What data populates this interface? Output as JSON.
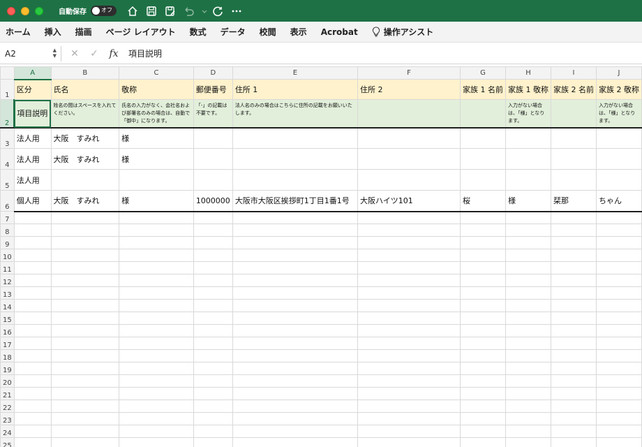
{
  "titlebar": {
    "autosave_label": "自動保存",
    "autosave_state": "オフ",
    "icons": [
      "home-icon",
      "save-icon",
      "save-as-icon",
      "undo-icon",
      "redo-icon",
      "more-icon"
    ]
  },
  "ribbon": {
    "tabs": [
      "ホーム",
      "挿入",
      "描画",
      "ページ レイアウト",
      "数式",
      "データ",
      "校閲",
      "表示",
      "Acrobat"
    ],
    "assist_label": "操作アシスト"
  },
  "formula_bar": {
    "name_box": "A2",
    "fx_label": "fx",
    "formula": "項目説明"
  },
  "grid": {
    "columns": [
      "A",
      "B",
      "C",
      "D",
      "E",
      "F",
      "G",
      "H",
      "I",
      "J"
    ],
    "selected_column": "A",
    "selected_row": 2,
    "rows": [
      {
        "n": "1",
        "cells": [
          "区分",
          "氏名",
          "敬称",
          "郵便番号",
          "住所 1",
          "住所 2",
          "家族 1 名前",
          "家族 1 敬称",
          "家族 2 名前",
          "家族 2 敬称"
        ]
      },
      {
        "n": "2",
        "cells": [
          "項目説明",
          "姓名の間はスペースを入れてください。",
          "氏名の入力がなく、会社名および部署名のみの場合は、自動で「御中」になります。",
          "「-」の記載は不要です。",
          "法人名のみの場合はこちらに住所の記載をお願いいたします。",
          "",
          "",
          "入力がない場合は、「様」となります。",
          "",
          "入力がない場合は、「様」となります。"
        ]
      },
      {
        "n": "3",
        "cells": [
          "法人用",
          "大阪　すみれ",
          "様",
          "",
          "",
          "",
          "",
          "",
          "",
          ""
        ]
      },
      {
        "n": "4",
        "cells": [
          "法人用",
          "大阪　すみれ",
          "様",
          "",
          "",
          "",
          "",
          "",
          "",
          ""
        ]
      },
      {
        "n": "5",
        "cells": [
          "法人用",
          "",
          "",
          "",
          "",
          "",
          "",
          "",
          "",
          ""
        ]
      },
      {
        "n": "6",
        "cells": [
          "個人用",
          "大阪　すみれ",
          "様",
          "1000000",
          "大阪市大阪区挨拶町1丁目1番1号",
          "大阪ハイツ101",
          "桜",
          "様",
          "栞那",
          "ちゃん"
        ]
      }
    ],
    "empty_row_numbers": [
      "7",
      "8",
      "9",
      "10",
      "11",
      "12",
      "13",
      "14",
      "15",
      "16",
      "17",
      "18",
      "19",
      "20",
      "21",
      "22",
      "23",
      "24",
      "25"
    ]
  }
}
